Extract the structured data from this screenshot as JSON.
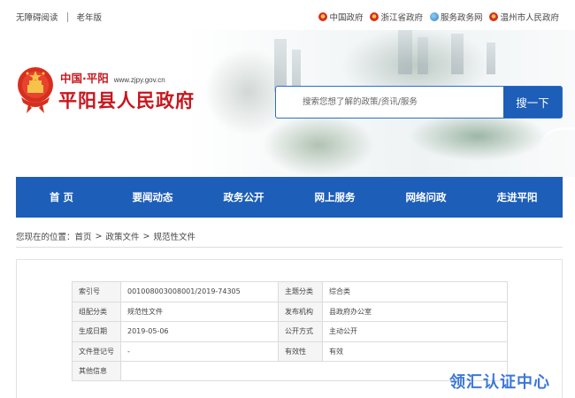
{
  "topbar": {
    "accessibility": "无障碍阅读",
    "elder": "老年版",
    "links": [
      {
        "label": "中国政府",
        "icon": "emblem-icon"
      },
      {
        "label": "浙江省政府",
        "icon": "emblem-icon"
      },
      {
        "label": "服务政务网",
        "icon": "globe-icon"
      },
      {
        "label": "温州市人民政府",
        "icon": "emblem-icon"
      }
    ]
  },
  "header": {
    "region": "中国·平阳",
    "url": "www.zjpy.gov.cn",
    "title": "平阳县人民政府",
    "brand_color": "#c8161d"
  },
  "search": {
    "placeholder": "搜索您想了解的政策/资讯/服务",
    "button": "搜一下"
  },
  "nav": {
    "color": "#1d5eb8",
    "items": [
      "首 页",
      "要闻动态",
      "政务公开",
      "网上服务",
      "网络问政",
      "走进平阳"
    ]
  },
  "breadcrumb": {
    "prefix": "您现在的位置：",
    "items": [
      "首页",
      "政策文件",
      "规范性文件"
    ]
  },
  "meta_table": {
    "rows": [
      {
        "k1": "索引号",
        "v1": "001008003008001/2019-74305",
        "k2": "主题分类",
        "v2": "综合类"
      },
      {
        "k1": "组配分类",
        "v1": "规范性文件",
        "k2": "发布机构",
        "v2": "县政府办公室"
      },
      {
        "k1": "生成日期",
        "v1": "2019-05-06",
        "k2": "公开方式",
        "v2": "主动公开"
      },
      {
        "k1": "文件登记号",
        "v1": "-",
        "k2": "有效性",
        "v2": "有效"
      },
      {
        "k1": "其他信息",
        "v1": "",
        "k2": "",
        "v2": ""
      }
    ]
  },
  "watermark": "领汇认证中心"
}
